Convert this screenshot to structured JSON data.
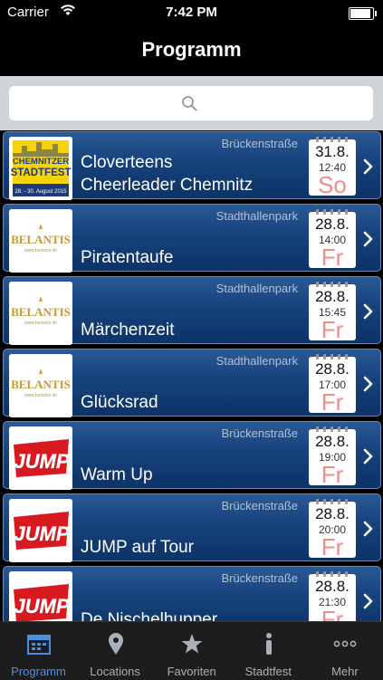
{
  "status_bar": {
    "carrier": "Carrier",
    "time": "7:42 PM"
  },
  "nav": {
    "title": "Programm"
  },
  "search": {
    "placeholder": ""
  },
  "events": [
    {
      "logo": "chemnitzer-stadtfest-logo",
      "logo_line1": "CHEMNITZER",
      "logo_line2": "STADTFEST",
      "logo_line3": "28. - 30. August 2015",
      "location": "Brückenstraße",
      "title_line1": "Cloverteens",
      "title_line2": "Cheerleader Chemnitz",
      "date": "31.8.",
      "time": "12:40",
      "weekday": "So"
    },
    {
      "logo": "belantis-logo",
      "logo_text": "BELANTIS",
      "logo_sub": "www.belantis.de",
      "location": "Stadthallenpark",
      "title_line1": "",
      "title_line2": "Piratentaufe",
      "date": "28.8.",
      "time": "14:00",
      "weekday": "Fr"
    },
    {
      "logo": "belantis-logo",
      "logo_text": "BELANTIS",
      "logo_sub": "www.belantis.de",
      "location": "Stadthallenpark",
      "title_line1": "",
      "title_line2": "Märchenzeit",
      "date": "28.8.",
      "time": "15:45",
      "weekday": "Fr"
    },
    {
      "logo": "belantis-logo",
      "logo_text": "BELANTIS",
      "logo_sub": "www.belantis.de",
      "location": "Stadthallenpark",
      "title_line1": "",
      "title_line2": "Glücksrad",
      "date": "28.8.",
      "time": "17:00",
      "weekday": "Fr"
    },
    {
      "logo": "jump-logo",
      "logo_text": "JUMP",
      "location": "Brückenstraße",
      "title_line1": "",
      "title_line2": "Warm Up",
      "date": "28.8.",
      "time": "19:00",
      "weekday": "Fr"
    },
    {
      "logo": "jump-logo",
      "logo_text": "JUMP",
      "location": "Brückenstraße",
      "title_line1": "",
      "title_line2": "JUMP auf Tour",
      "date": "28.8.",
      "time": "20:00",
      "weekday": "Fr"
    },
    {
      "logo": "jump-logo",
      "logo_text": "JUMP",
      "location": "Brückenstraße",
      "title_line1": "",
      "title_line2": "De Nischelhupper",
      "date": "28.8.",
      "time": "21:30",
      "weekday": "Fr"
    }
  ],
  "tabs": [
    {
      "label": "Programm",
      "icon": "calendar-icon",
      "active": true
    },
    {
      "label": "Locations",
      "icon": "location-pin-icon",
      "active": false
    },
    {
      "label": "Favoriten",
      "icon": "star-icon",
      "active": false
    },
    {
      "label": "Stadtfest",
      "icon": "info-icon",
      "active": false
    },
    {
      "label": "Mehr",
      "icon": "more-icon",
      "active": false
    }
  ],
  "colors": {
    "tab_active": "#4b8fe0",
    "cell_blue": "#16427c",
    "weekday_red": "#f28c8c"
  }
}
